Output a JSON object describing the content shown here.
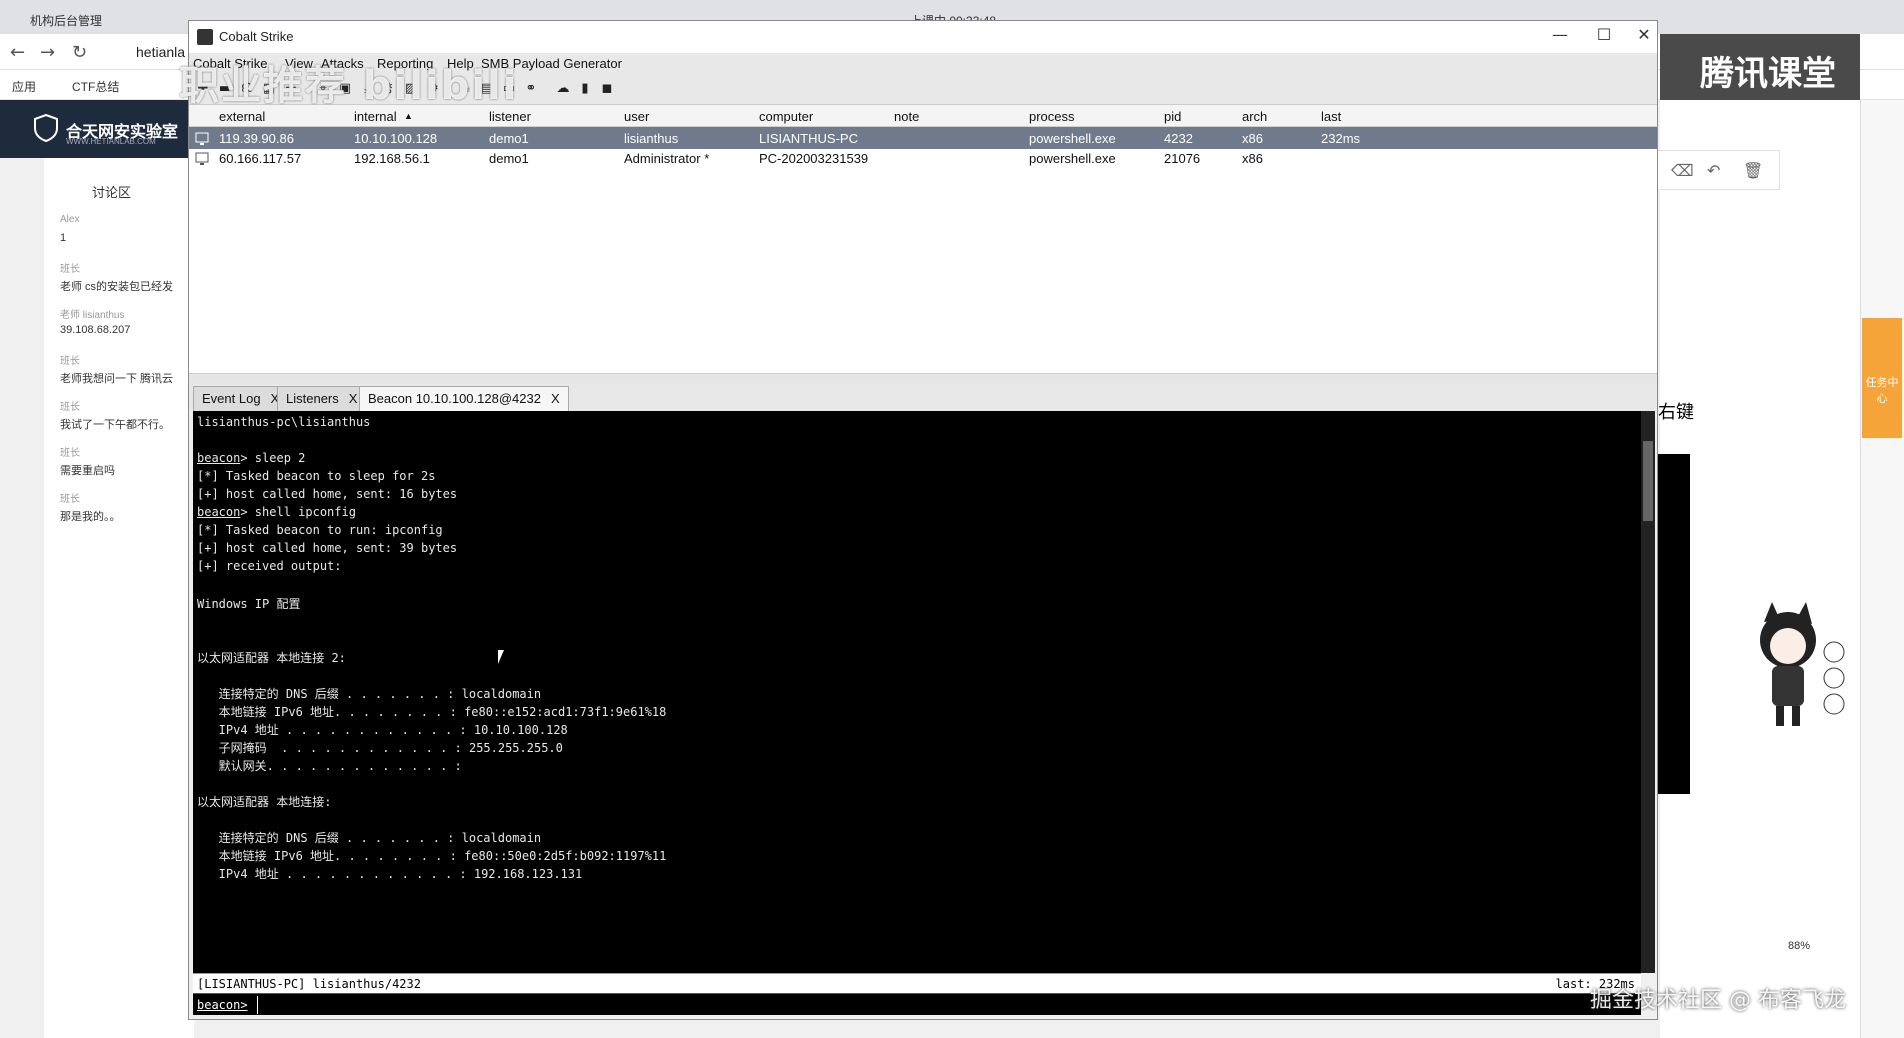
{
  "browser": {
    "tab1": "机构后台管理",
    "status": "上课中 00:33:48",
    "url": "hetianla"
  },
  "bookmarks": [
    "应用",
    "CTF总结"
  ],
  "site": {
    "logo_text": "合天网安实验室",
    "logo_sub": "WWW.HETIANLAB.COM"
  },
  "chat": {
    "title": "讨论区",
    "messages": [
      {
        "name": "Alex",
        "text": "1"
      },
      {
        "name": "班长",
        "text": "老师 cs的安装包已经发"
      },
      {
        "name": "老师 lisianthus",
        "text": "39.108.68.207"
      },
      {
        "name": "班长",
        "text": "老师我想问一下 腾讯云"
      },
      {
        "name": "班长",
        "text": "我试了一下午都不行。"
      },
      {
        "name": "班长",
        "text": "需要重启吗"
      },
      {
        "name": "班长",
        "text": "那是我的。。"
      }
    ]
  },
  "right": {
    "banner": "腾讯课堂",
    "label": "右键",
    "task": "任务中心",
    "zoom": "88%"
  },
  "window": {
    "title": "Cobalt Strike",
    "minimize": "—",
    "maximize": "☐",
    "close": "✕"
  },
  "menu": [
    "Cobalt Strike",
    "View",
    "Attacks",
    "Reporting",
    "Help",
    "SMB Payload Generator"
  ],
  "watermark_top": "职业推荐 bilibili",
  "toolbar_icons": [
    "plus-icon",
    "minus-icon",
    "headphones-icon",
    "grid-icon",
    "list-icon",
    "target-icon",
    "image-icon",
    "download-icon",
    "key-icon",
    "picture-icon",
    "gear-icon",
    "coffee-icon",
    "doc-icon",
    "terminal-icon",
    "link-icon",
    "cloud-icon",
    "book-icon",
    "cube-icon"
  ],
  "sessions": {
    "columns": [
      "external",
      "internal",
      "listener",
      "user",
      "computer",
      "note",
      "process",
      "pid",
      "arch",
      "last"
    ],
    "sort_indicator": "▲",
    "rows": [
      {
        "external": "119.39.90.86",
        "internal": "10.10.100.128",
        "listener": "demo1",
        "user": "lisianthus",
        "computer": "LISIANTHUS-PC",
        "note": "",
        "process": "powershell.exe",
        "pid": "4232",
        "arch": "x86",
        "last": "232ms",
        "selected": true
      },
      {
        "external": "60.166.117.57",
        "internal": "192.168.56.1",
        "listener": "demo1",
        "user": "Administrator *",
        "computer": "PC-202003231539",
        "note": "",
        "process": "powershell.exe",
        "pid": "21076",
        "arch": "x86",
        "last": "",
        "selected": false
      }
    ]
  },
  "tabs": [
    {
      "label": "Event Log",
      "close": "X"
    },
    {
      "label": "Listeners",
      "close": "X"
    },
    {
      "label": "Beacon 10.10.100.128@4232",
      "close": "X"
    }
  ],
  "console": {
    "lines": [
      {
        "t": "lisianthus-pc\\lisianthus"
      },
      {
        "t": ""
      },
      {
        "p": "beacon",
        "t": "> sleep 2"
      },
      {
        "t": "[*] Tasked beacon to sleep for 2s"
      },
      {
        "t": "[+] host called home, sent: 16 bytes"
      },
      {
        "p": "beacon",
        "t": "> shell ipconfig"
      },
      {
        "t": "[*] Tasked beacon to run: ipconfig"
      },
      {
        "t": "[+] host called home, sent: 39 bytes"
      },
      {
        "t": "[+] received output:"
      },
      {
        "t": ""
      },
      {
        "t": "Windows IP 配置"
      },
      {
        "t": ""
      },
      {
        "t": ""
      },
      {
        "t": "以太网适配器 本地连接 2:"
      },
      {
        "t": ""
      },
      {
        "t": "   连接特定的 DNS 后缀 . . . . . . . : localdomain"
      },
      {
        "t": "   本地链接 IPv6 地址. . . . . . . . : fe80::e152:acd1:73f1:9e61%18"
      },
      {
        "t": "   IPv4 地址 . . . . . . . . . . . . : 10.10.100.128"
      },
      {
        "t": "   子网掩码  . . . . . . . . . . . . : 255.255.255.0"
      },
      {
        "t": "   默认网关. . . . . . . . . . . . . :"
      },
      {
        "t": ""
      },
      {
        "t": "以太网适配器 本地连接:"
      },
      {
        "t": ""
      },
      {
        "t": "   连接特定的 DNS 后缀 . . . . . . . : localdomain"
      },
      {
        "t": "   本地链接 IPv6 地址. . . . . . . . : fe80::50e0:2d5f:b092:1197%11"
      },
      {
        "t": "   IPv4 地址 . . . . . . . . . . . . : 192.168.123.131"
      }
    ]
  },
  "status": {
    "left": "[LISIANTHUS-PC] lisianthus/4232",
    "right": "last: 232ms"
  },
  "input": {
    "prompt": "beacon>",
    "value": ""
  },
  "watermark_bottom": "掘金技术社区 @ 布客飞龙"
}
